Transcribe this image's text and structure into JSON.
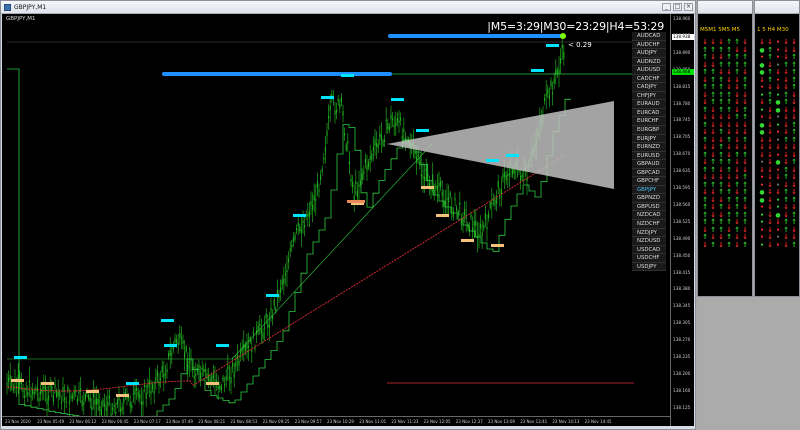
{
  "window": {
    "title": "GBPJPY,M1"
  },
  "chart": {
    "symbol_label": "GBPJPY,M1",
    "tf_readout": "|M5=3:29|M30=23:29|H4=53:29",
    "diff_label": "< 0.29",
    "price_ticks": [
      "138.960",
      "138.925",
      "138.890",
      "138.850",
      "138.815",
      "138.780",
      "138.745",
      "138.705",
      "138.670",
      "138.635",
      "138.595",
      "138.560",
      "138.525",
      "138.490",
      "138.450",
      "138.415",
      "138.380",
      "138.345",
      "138.305",
      "138.270",
      "138.235",
      "138.200",
      "138.160",
      "138.125"
    ],
    "price_badges": [
      {
        "label": "138.938",
        "color": "#ffffff"
      },
      {
        "label": "138.868",
        "color": "#00e000"
      }
    ],
    "time_ticks": [
      "23 Nov 2020",
      "23 Nov 05:49",
      "23 Nov 06:12",
      "23 Nov 06:45",
      "23 Nov 07:17",
      "23 Nov 07:49",
      "23 Nov 08:21",
      "23 Nov 08:53",
      "23 Nov 09:25",
      "23 Nov 09:57",
      "23 Nov 10:29",
      "23 Nov 11:01",
      "23 Nov 11:33",
      "23 Nov 12:05",
      "23 Nov 12:37",
      "23 Nov 13:09",
      "23 Nov 13:41",
      "23 Nov 14:13",
      "23 Nov 14:45"
    ],
    "symbols": [
      "AUDCAD",
      "AUDCHF",
      "AUDJPY",
      "AUDNZD",
      "AUDUSD",
      "CADCHF",
      "CADJPY",
      "CHFJPY",
      "EURAUD",
      "EURCAD",
      "EURCHF",
      "EURGBP",
      "EURJPY",
      "EURNZD",
      "EURUSD",
      "GBPAUD",
      "GBPCAD",
      "GBPCHF",
      "GBPJPY",
      "GBPNZD",
      "GBPUSD",
      "NZDCAD",
      "NZDCHF",
      "NZDJPY",
      "NZDUSD",
      "USDCAD",
      "USDCHF",
      "USDJPY"
    ],
    "active_symbol": "GBPJPY",
    "colors": {
      "candles": "#1faa1f",
      "ma_green": "#2ecc40",
      "ma_red": "#e0303a",
      "level_blue": "#1e90ff",
      "swing_cyan": "#00e5ff",
      "swing_tan": "#f4c27a"
    }
  },
  "side_panels": [
    {
      "header": "M5M1 5M5 M5"
    },
    {
      "header": "1 5 H4 M30"
    }
  ],
  "icons": {
    "minimize": "minimize-icon",
    "maximize": "maximize-icon",
    "close": "close-icon"
  }
}
